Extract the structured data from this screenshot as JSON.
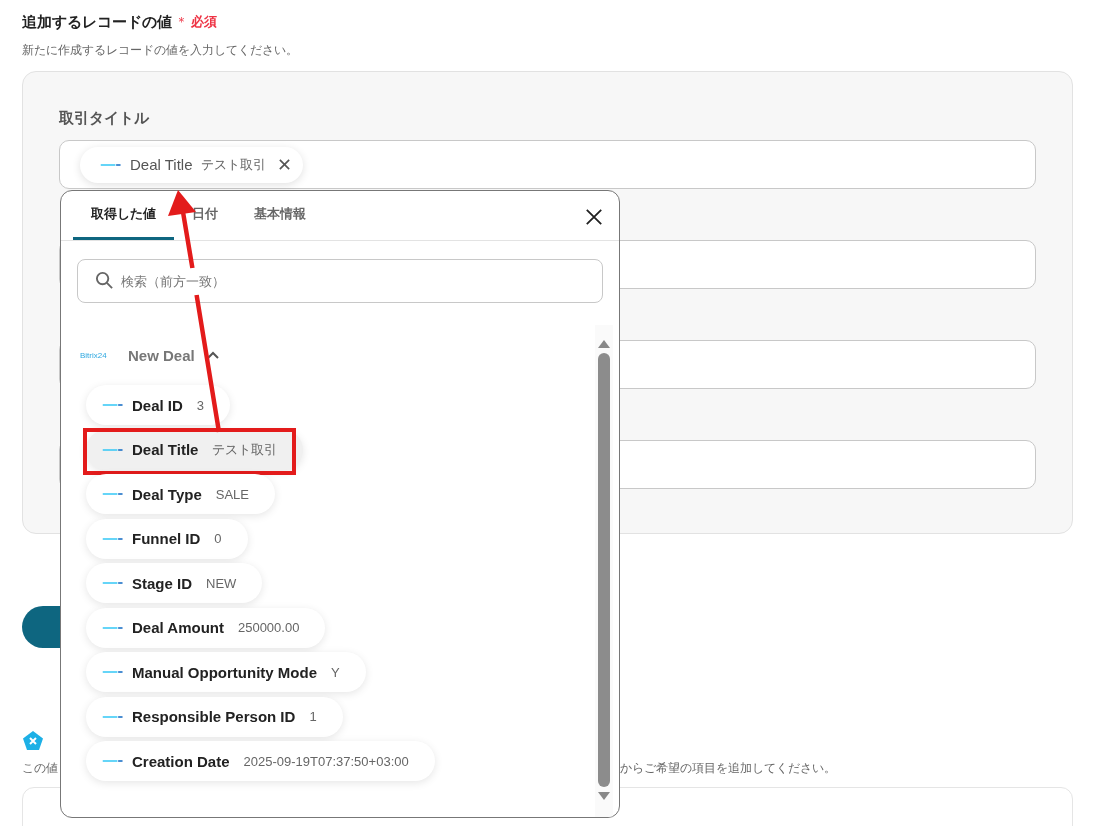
{
  "section": {
    "title": "追加するレコードの値",
    "required_mark": "＊",
    "required_label": "必須",
    "description": "新たに作成するレコードの値を入力してください。"
  },
  "fields": [
    {
      "kind": "token",
      "label": "取引タイトル",
      "token": {
        "name": "Deal Title",
        "value": "テスト取引"
      }
    },
    {
      "kind": "blank"
    },
    {
      "kind": "blank"
    },
    {
      "kind": "blank"
    }
  ],
  "popup": {
    "tabs": [
      {
        "label": "取得した値",
        "selected": true
      },
      {
        "label": "日付",
        "selected": false
      },
      {
        "label": "基本情報",
        "selected": false
      }
    ],
    "search": {
      "placeholder": "検索（前方一致）"
    },
    "group": {
      "logo_text": "Bitrix24",
      "title": "New Deal",
      "expanded": true,
      "items": [
        {
          "name": "Deal ID",
          "value": "3",
          "selected": false
        },
        {
          "name": "Deal Title",
          "value": "テスト取引",
          "selected": true
        },
        {
          "name": "Deal Type",
          "value": "SALE",
          "selected": false
        },
        {
          "name": "Funnel ID",
          "value": "0",
          "selected": false
        },
        {
          "name": "Stage ID",
          "value": "NEW",
          "selected": false
        },
        {
          "name": "Deal Amount",
          "value": "250000.00",
          "selected": false
        },
        {
          "name": "Manual Opportunity Mode",
          "value": "Y",
          "selected": false
        },
        {
          "name": "Responsible Person ID",
          "value": "1",
          "selected": false
        },
        {
          "name": "Creation Date",
          "value": "2025-09-19T07:37:50+03:00",
          "selected": false
        }
      ]
    }
  },
  "section2": {
    "description_left": "この値",
    "description_right": "からご希望の項目を追加してください。"
  }
}
